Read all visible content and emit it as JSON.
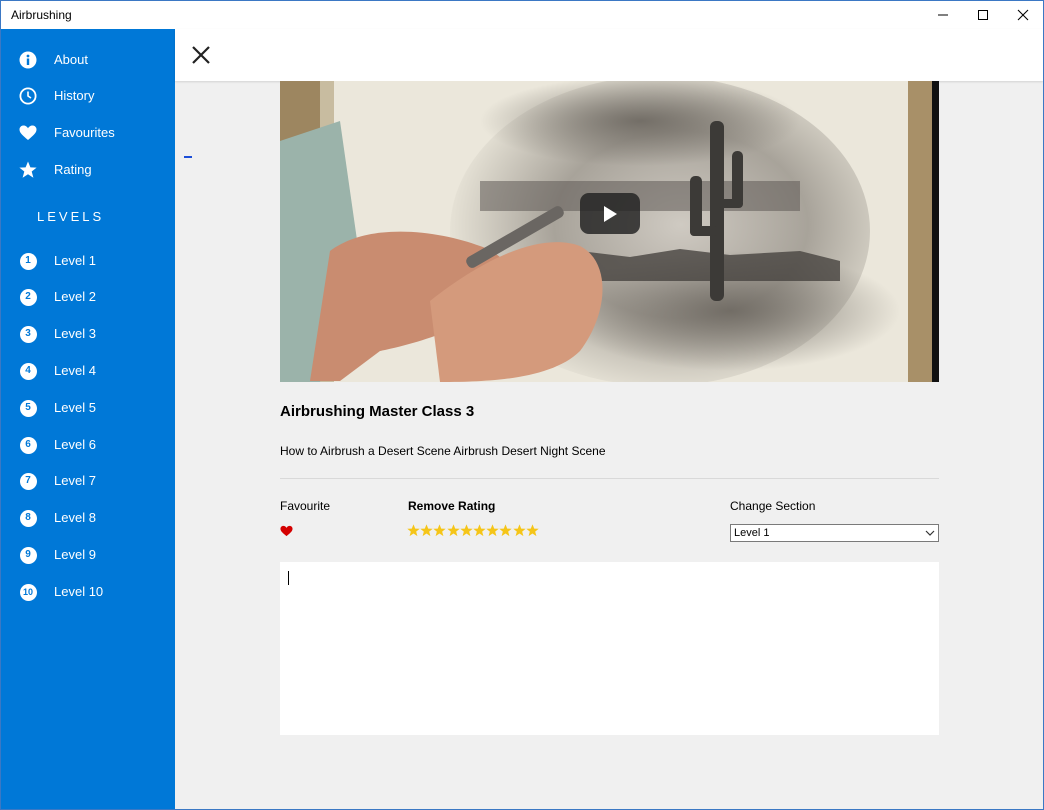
{
  "window": {
    "title": "Airbrushing"
  },
  "sidebar": {
    "nav": [
      {
        "label": "About",
        "icon": "info-icon"
      },
      {
        "label": "History",
        "icon": "clock-icon"
      },
      {
        "label": "Favourites",
        "icon": "heart-icon"
      },
      {
        "label": "Rating",
        "icon": "star-icon"
      }
    ],
    "levels_header": "LEVELS",
    "levels": [
      {
        "num": "1",
        "label": "Level 1"
      },
      {
        "num": "2",
        "label": "Level 2"
      },
      {
        "num": "3",
        "label": "Level 3"
      },
      {
        "num": "4",
        "label": "Level 4"
      },
      {
        "num": "5",
        "label": "Level 5"
      },
      {
        "num": "6",
        "label": "Level 6"
      },
      {
        "num": "7",
        "label": "Level 7"
      },
      {
        "num": "8",
        "label": "Level 8"
      },
      {
        "num": "9",
        "label": "Level 9"
      },
      {
        "num": "10",
        "label": "Level 10"
      }
    ]
  },
  "video": {
    "title": "Airbrushing Master Class 3",
    "description": "How to Airbrush a Desert Scene Airbrush Desert Night Scene"
  },
  "details": {
    "favourite_label": "Favourite",
    "favourite": true,
    "rating_label": "Remove Rating",
    "rating": 10,
    "rating_max": 10,
    "section_label": "Change Section",
    "section_value": "Level 1"
  },
  "notes": {
    "value": ""
  },
  "colors": {
    "accent": "#0078d7",
    "star": "#f5c518",
    "heart": "#d40000"
  }
}
